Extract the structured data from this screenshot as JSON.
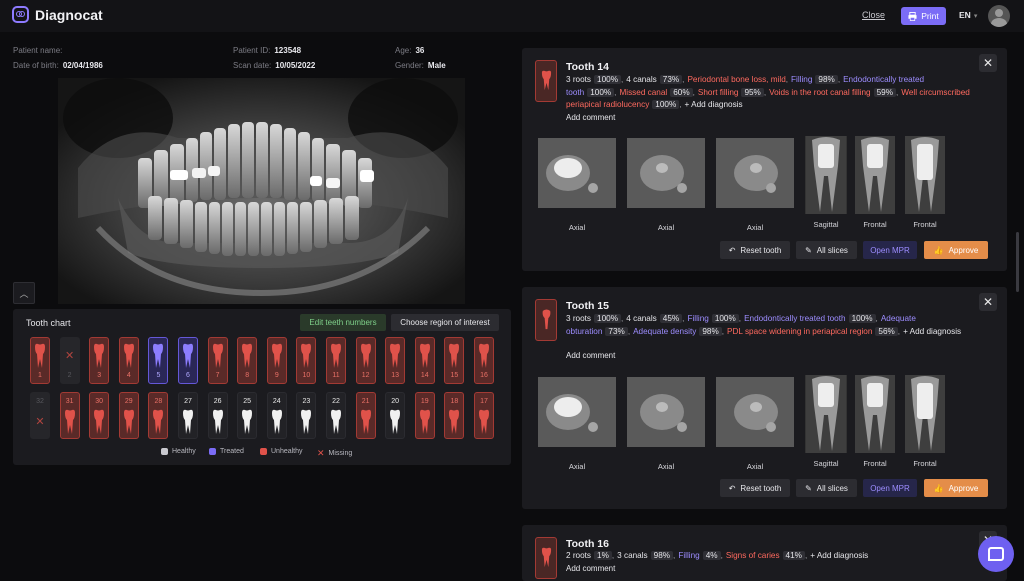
{
  "app": {
    "name": "Diagnocat"
  },
  "header": {
    "close_label": "Close",
    "print_label": "Print",
    "lang": "EN"
  },
  "patient": {
    "name_label": "Patient name:",
    "name_value": "",
    "dob_label": "Date of birth:",
    "dob_value": "02/04/1986",
    "id_label": "Patient ID:",
    "id_value": "123548",
    "scan_label": "Scan date:",
    "scan_value": "10/05/2022",
    "age_label": "Age:",
    "age_value": "36",
    "gender_label": "Gender:",
    "gender_value": "Male"
  },
  "chart": {
    "title": "Tooth chart",
    "edit_label": "Edit teeth numbers",
    "roi_label": "Choose region of interest",
    "upper": [
      {
        "n": "1",
        "s": "unhealthy"
      },
      {
        "n": "2",
        "s": "missing"
      },
      {
        "n": "3",
        "s": "unhealthy"
      },
      {
        "n": "4",
        "s": "unhealthy"
      },
      {
        "n": "5",
        "s": "treated"
      },
      {
        "n": "6",
        "s": "treated"
      },
      {
        "n": "7",
        "s": "unhealthy"
      },
      {
        "n": "8",
        "s": "unhealthy"
      },
      {
        "n": "9",
        "s": "unhealthy"
      },
      {
        "n": "10",
        "s": "unhealthy"
      },
      {
        "n": "11",
        "s": "unhealthy"
      },
      {
        "n": "12",
        "s": "unhealthy"
      },
      {
        "n": "13",
        "s": "unhealthy"
      },
      {
        "n": "14",
        "s": "unhealthy"
      },
      {
        "n": "15",
        "s": "unhealthy"
      },
      {
        "n": "16",
        "s": "unhealthy"
      }
    ],
    "lower": [
      {
        "n": "32",
        "s": "missing"
      },
      {
        "n": "31",
        "s": "unhealthy"
      },
      {
        "n": "30",
        "s": "unhealthy"
      },
      {
        "n": "29",
        "s": "unhealthy"
      },
      {
        "n": "28",
        "s": "unhealthy"
      },
      {
        "n": "27",
        "s": "healthy"
      },
      {
        "n": "26",
        "s": "healthy"
      },
      {
        "n": "25",
        "s": "healthy"
      },
      {
        "n": "24",
        "s": "healthy"
      },
      {
        "n": "23",
        "s": "healthy"
      },
      {
        "n": "22",
        "s": "healthy"
      },
      {
        "n": "21",
        "s": "unhealthy"
      },
      {
        "n": "20",
        "s": "healthy"
      },
      {
        "n": "19",
        "s": "unhealthy"
      },
      {
        "n": "18",
        "s": "unhealthy"
      },
      {
        "n": "17",
        "s": "unhealthy"
      }
    ],
    "legend": {
      "healthy": "Healthy",
      "treated": "Treated",
      "unhealthy": "Unhealthy",
      "missing": "Missing"
    },
    "colors": {
      "healthy": "#c9c9cf",
      "treated": "#7b6cf6",
      "unhealthy": "#e0524a",
      "missing": "#e0524a"
    }
  },
  "cards": [
    {
      "title": "Tooth 14",
      "diagnoses": [
        {
          "t": "3 roots",
          "p": "100%",
          "c": "white"
        },
        {
          "t": "4 canals",
          "p": "73%",
          "c": "white"
        },
        {
          "t": "Periodontal bone loss, mild",
          "p": "",
          "c": "red"
        },
        {
          "t": "Filling",
          "p": "98%",
          "c": "purple"
        },
        {
          "t": "Endodontically treated tooth",
          "p": "100%",
          "c": "purple"
        },
        {
          "t": "Missed canal",
          "p": "60%",
          "c": "red"
        },
        {
          "t": "Short filling",
          "p": "95%",
          "c": "red"
        },
        {
          "t": "Voids in the root canal filling",
          "p": "59%",
          "c": "red"
        },
        {
          "t": "Well circumscribed periapical radiolucency",
          "p": "100%",
          "c": "red"
        }
      ],
      "add_diagnosis": "+ Add diagnosis",
      "add_comment": "Add comment",
      "slices": [
        "Axial",
        "Axial",
        "Axial",
        "Sagittal",
        "Frontal",
        "Frontal"
      ],
      "actions": {
        "reset": "Reset tooth",
        "all": "All slices",
        "mpr": "Open MPR",
        "approve": "Approve"
      }
    },
    {
      "title": "Tooth 15",
      "diagnoses": [
        {
          "t": "3 roots",
          "p": "100%",
          "c": "white"
        },
        {
          "t": "4 canals",
          "p": "45%",
          "c": "white"
        },
        {
          "t": "Filling",
          "p": "100%",
          "c": "purple"
        },
        {
          "t": "Endodontically treated tooth",
          "p": "100%",
          "c": "purple"
        },
        {
          "t": "Adequate obturation",
          "p": "73%",
          "c": "purple"
        },
        {
          "t": "Adequate density",
          "p": "98%",
          "c": "purple"
        },
        {
          "t": "PDL space widening in periapical region",
          "p": "56%",
          "c": "red"
        }
      ],
      "add_diagnosis": "+ Add diagnosis",
      "add_comment": "Add comment",
      "slices": [
        "Axial",
        "Axial",
        "Axial",
        "Sagittal",
        "Frontal",
        "Frontal"
      ],
      "actions": {
        "reset": "Reset tooth",
        "all": "All slices",
        "mpr": "Open MPR",
        "approve": "Approve"
      }
    },
    {
      "title": "Tooth 16",
      "diagnoses": [
        {
          "t": "2 roots",
          "p": "1%",
          "c": "white"
        },
        {
          "t": "3 canals",
          "p": "98%",
          "c": "white"
        },
        {
          "t": "Filling",
          "p": "4%",
          "c": "purple"
        },
        {
          "t": "Signs of caries",
          "p": "41%",
          "c": "red"
        }
      ],
      "add_diagnosis": "+ Add diagnosis",
      "add_comment": "Add comment"
    }
  ]
}
